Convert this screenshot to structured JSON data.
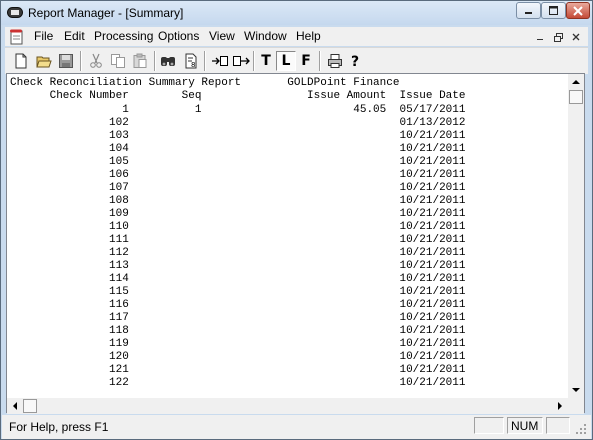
{
  "window": {
    "title": "Report Manager - [Summary]"
  },
  "menu": [
    "File",
    "Edit",
    "Processing",
    "Options",
    "View",
    "Window",
    "Help"
  ],
  "toolbar": {
    "letter_buttons": [
      "T",
      "L",
      "F"
    ]
  },
  "report": {
    "title_line": "Check Reconciliation Summary Report       GOLDPoint Finance",
    "header_line": "      Check Number        Seq                Issue Amount  Issue Date                  Cleared Amount",
    "rows": [
      {
        "text": "                 1          1                       45.05  05/17/2011"
      },
      {
        "text": "               102                                         01/13/2012"
      },
      {
        "text": "               103                                         10/21/2011"
      },
      {
        "text": "               104                                         10/21/2011"
      },
      {
        "text": "               105                                         10/21/2011"
      },
      {
        "text": "               106                                         10/21/2011"
      },
      {
        "text": "               107                                         10/21/2011"
      },
      {
        "text": "               108                                         10/21/2011"
      },
      {
        "text": "               109                                         10/21/2011"
      },
      {
        "text": "               110                                         10/21/2011"
      },
      {
        "text": "               111                                         10/21/2011"
      },
      {
        "text": "               112                                         10/21/2011"
      },
      {
        "text": "               113                                         10/21/2011"
      },
      {
        "text": "               114                                         10/21/2011"
      },
      {
        "text": "               115                                         10/21/2011"
      },
      {
        "text": "               116                                         10/21/2011"
      },
      {
        "text": "               117                                         10/21/2011"
      },
      {
        "text": "               118                                         10/21/2011"
      },
      {
        "text": "               119                                         10/21/2011"
      },
      {
        "text": "               120                                         10/21/2011"
      },
      {
        "text": "               121                                         10/21/2011"
      },
      {
        "text": "               122                                         10/21/2011"
      }
    ]
  },
  "status": {
    "help_text": "For Help, press F1",
    "num_indicator": "NUM"
  }
}
